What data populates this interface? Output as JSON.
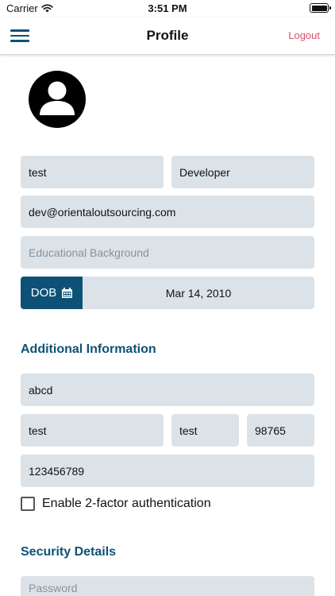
{
  "status_bar": {
    "carrier": "Carrier",
    "time": "3:51 PM"
  },
  "nav": {
    "title": "Profile",
    "logout_label": "Logout"
  },
  "profile": {
    "first_name": "test",
    "last_name": "Developer",
    "email": "dev@orientaloutsourcing.com",
    "education_placeholder": "Educational Background",
    "dob_label": "DOB",
    "dob_value": "Mar 14, 2010"
  },
  "additional": {
    "title": "Additional Information",
    "address": "abcd",
    "city": "test",
    "state": "test",
    "zip": "98765",
    "phone": "123456789",
    "two_factor_label": "Enable 2-factor authentication",
    "two_factor_checked": false
  },
  "security": {
    "title": "Security Details",
    "password_placeholder": "Password"
  },
  "colors": {
    "primary": "#0d5276",
    "logout": "#e0506b",
    "field_bg": "#dbe3e9"
  },
  "icons": {
    "menu": "hamburger-menu-icon",
    "avatar": "user-avatar-icon",
    "calendar": "calendar-icon",
    "wifi": "wifi-icon",
    "battery": "battery-icon"
  }
}
